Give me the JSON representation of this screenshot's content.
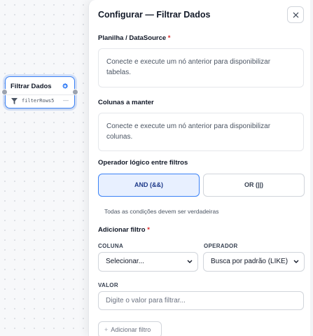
{
  "canvas": {
    "node": {
      "title": "Filtrar Dados",
      "subtitle": "filterRows5",
      "dash": "—",
      "icons": {
        "settings": "gear-icon",
        "type": "filter-icon"
      },
      "accent": "#3b82f6"
    }
  },
  "panel": {
    "title": "Configurar — Filtrar Dados",
    "close_icon": "close-icon",
    "datasource": {
      "label": "Planilha / DataSource",
      "required_mark": "*",
      "notice": "Conecte e execute um nó anterior para disponibilizar tabelas."
    },
    "columns": {
      "label": "Colunas a manter",
      "notice": "Conecte e execute um nó anterior para disponibilizar colunas."
    },
    "logic": {
      "label": "Operador lógico entre filtros",
      "options": [
        {
          "label": "AND (&&)",
          "selected": true
        },
        {
          "label": "OR (||)",
          "selected": false
        }
      ],
      "hint": "Todas as condições devem ser verdadeiras"
    },
    "add_filter": {
      "label": "Adicionar filtro",
      "required_mark": "*",
      "column_label": "COLUNA",
      "column_value": "Selecionar...",
      "operator_label": "OPERADOR",
      "operator_value": "Busca por padrão (LIKE)",
      "value_label": "VALOR",
      "value_placeholder": "Digite o valor para filtrar...",
      "button_plus": "+",
      "button_label": "Adicionar filtro"
    }
  }
}
